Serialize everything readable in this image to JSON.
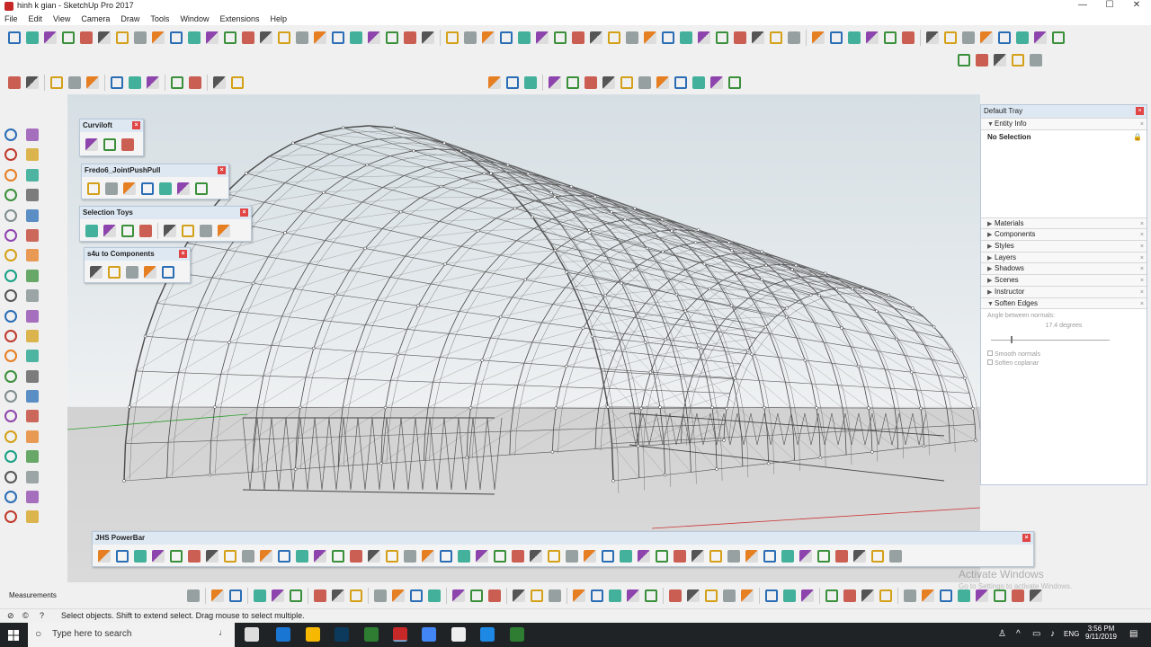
{
  "window": {
    "title": "hinh k gian - SketchUp Pro 2017",
    "controls": [
      "—",
      "☐",
      "✕"
    ]
  },
  "menu": [
    "File",
    "Edit",
    "View",
    "Camera",
    "Draw",
    "Tools",
    "Window",
    "Extensions",
    "Help"
  ],
  "panels": {
    "curviloft": {
      "title": "Curviloft"
    },
    "joint_push_pull": {
      "title": "Fredo6_JointPushPull"
    },
    "selection_toys": {
      "title": "Selection Toys"
    },
    "s4u_components": {
      "title": "s4u to Components"
    },
    "jhs_powerbar": {
      "title": "JHS PowerBar"
    }
  },
  "tray": {
    "title": "Default Tray",
    "entity_info": {
      "label": "Entity Info",
      "selection": "No Selection"
    },
    "sections": [
      "Materials",
      "Components",
      "Styles",
      "Layers",
      "Shadows",
      "Scenes",
      "Instructor"
    ],
    "soften_edges": {
      "label": "Soften Edges",
      "angle_label": "Angle between normals:",
      "angle_value": "17.4  degrees",
      "smooth_normals": "Smooth normals",
      "soften_coplanar": "Soften coplanar"
    }
  },
  "measurements": {
    "label": "Measurements"
  },
  "status": {
    "text": "Select objects. Shift to extend select. Drag mouse to select multiple."
  },
  "watermark": {
    "title": "Activate Windows",
    "subtitle": "Go to Settings to activate Windows."
  },
  "taskbar": {
    "search_placeholder": "Type here to search",
    "lang": "ENG",
    "time": "3:56 PM",
    "date": "9/11/2019"
  }
}
